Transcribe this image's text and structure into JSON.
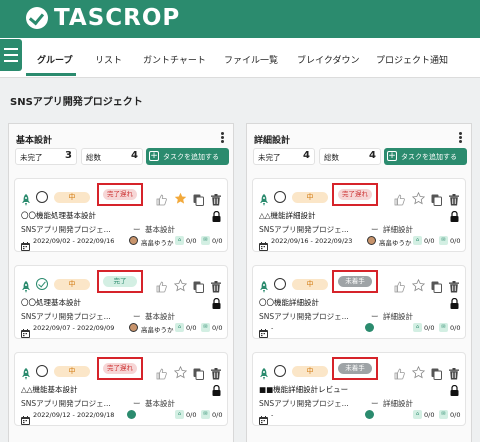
{
  "header": {
    "brand": "TASCROP"
  },
  "nav": {
    "tabs": [
      "グループ",
      "リスト",
      "ガントチャート",
      "ファイル一覧",
      "ブレイクダウン",
      "プロジェクト通知"
    ],
    "active_index": 0
  },
  "project": {
    "title": "SNSアプリ開発プロジェクト"
  },
  "columns": [
    {
      "name": "基本設計",
      "incomplete_label": "未完了",
      "incomplete_count": "3",
      "total_label": "総数",
      "total_count": "4",
      "add_button": "タスクを追加する",
      "cards": [
        {
          "priority": "中",
          "status": "完了遅れ",
          "completed": false,
          "starred": true,
          "task_name": "〇〇機能処理基本設計",
          "project": "SNSアプリ開発プロジェ...",
          "separator": "ー",
          "category": "基本設計",
          "dates": "2022/09/02 - 2022/09/16",
          "assignee": "高畠ゆうか",
          "subtasks": "0/0",
          "comments": "0/0"
        },
        {
          "priority": "中",
          "status": "完了",
          "completed": true,
          "starred": false,
          "task_name": "〇〇処理基本設計",
          "project": "SNSアプリ開発プロジェ...",
          "separator": "ー",
          "category": "基本設計",
          "dates": "2022/09/07 - 2022/09/09",
          "assignee": "高畠ゆうか",
          "subtasks": "0/0",
          "comments": "0/0"
        },
        {
          "priority": "中",
          "status": "完了遅れ",
          "completed": false,
          "starred": false,
          "task_name": "△△機能基本設計",
          "project": "SNSアプリ開発プロジェ...",
          "separator": "ー",
          "category": "基本設計",
          "dates": "2022/09/12 - 2022/09/18",
          "assignee": "",
          "subtasks": "0/0",
          "comments": "0/0"
        }
      ]
    },
    {
      "name": "詳細設計",
      "incomplete_label": "未完了",
      "incomplete_count": "4",
      "total_label": "総数",
      "total_count": "4",
      "add_button": "タスクを追加する",
      "cards": [
        {
          "priority": "中",
          "status": "完了遅れ",
          "completed": false,
          "starred": false,
          "task_name": "△△機能詳細設計",
          "project": "SNSアプリ開発プロジェ...",
          "separator": "ー",
          "category": "詳細設計",
          "dates": "2022/09/16 - 2022/09/23",
          "assignee": "高畠ゆうか",
          "subtasks": "0/0",
          "comments": "0/0"
        },
        {
          "priority": "中",
          "status": "未着手",
          "completed": false,
          "starred": false,
          "task_name": "〇〇機能詳細設計",
          "project": "SNSアプリ開発プロジェ...",
          "separator": "ー",
          "category": "詳細設計",
          "dates": "-",
          "assignee": "",
          "subtasks": "0/0",
          "comments": "0/0"
        },
        {
          "priority": "中",
          "status": "未着手",
          "completed": false,
          "starred": false,
          "task_name": "■■機能詳細設計レビュー",
          "project": "SNSアプリ開発プロジェ...",
          "separator": "ー",
          "category": "詳細設計",
          "dates": "-",
          "assignee": "",
          "subtasks": "0/0",
          "comments": "0/0"
        }
      ]
    }
  ],
  "colors": {
    "brand_green": "#2b8b6e",
    "late": "#c33",
    "highlight_box": "#d6232a",
    "priority_orange": "#d27a10",
    "star": "#f2a93b"
  }
}
